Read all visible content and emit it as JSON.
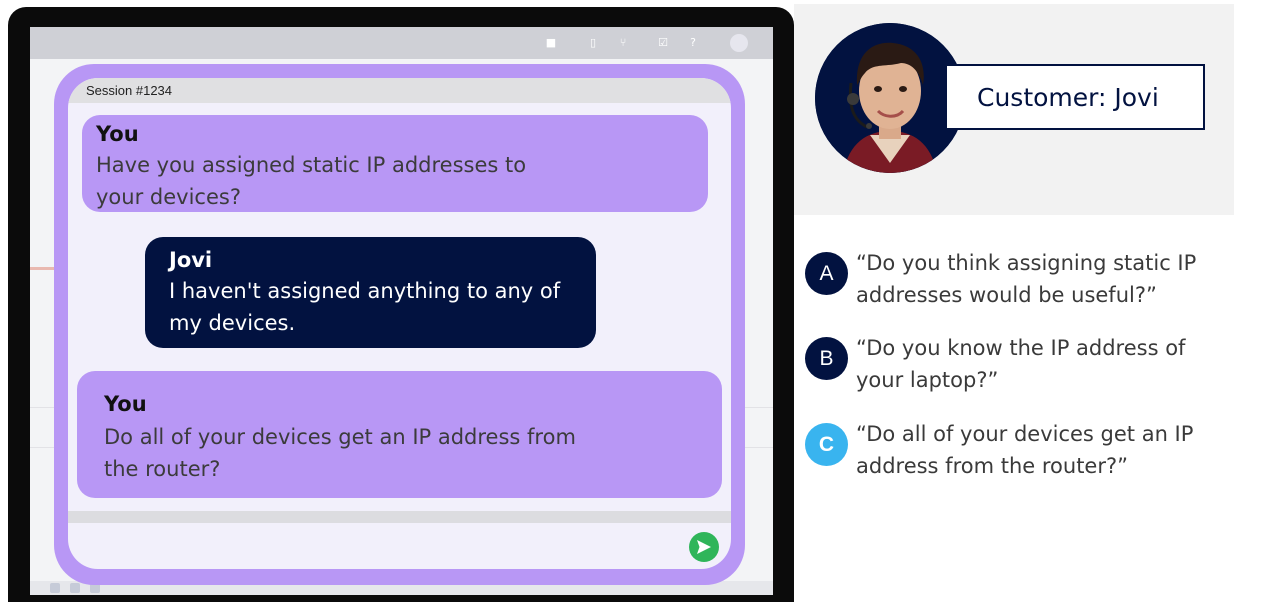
{
  "chat": {
    "session_label": "Session #1234",
    "messages": [
      {
        "sender": "You",
        "text": "Have you assigned static IP addresses to your devices?"
      },
      {
        "sender": "Jovi",
        "text": "I haven't assigned anything to any of my devices."
      },
      {
        "sender": "You",
        "text": "Do all of your devices get an IP address from the router?"
      }
    ]
  },
  "customer": {
    "label": "Customer: Jovi"
  },
  "options": [
    {
      "letter": "A",
      "text": "“Do you think assigning static IP addresses would be useful?”",
      "selected": false
    },
    {
      "letter": "B",
      "text": "“Do you know the IP address of your laptop?”",
      "selected": false
    },
    {
      "letter": "C",
      "text": "“Do all of your devices get an IP address from the router?”",
      "selected": true
    }
  ],
  "colors": {
    "navy": "#021240",
    "lavender": "#b897f5",
    "selected_badge": "#39b4ef",
    "send_button": "#2fb55a"
  },
  "icons": [
    "send-icon",
    "customer-avatar"
  ]
}
